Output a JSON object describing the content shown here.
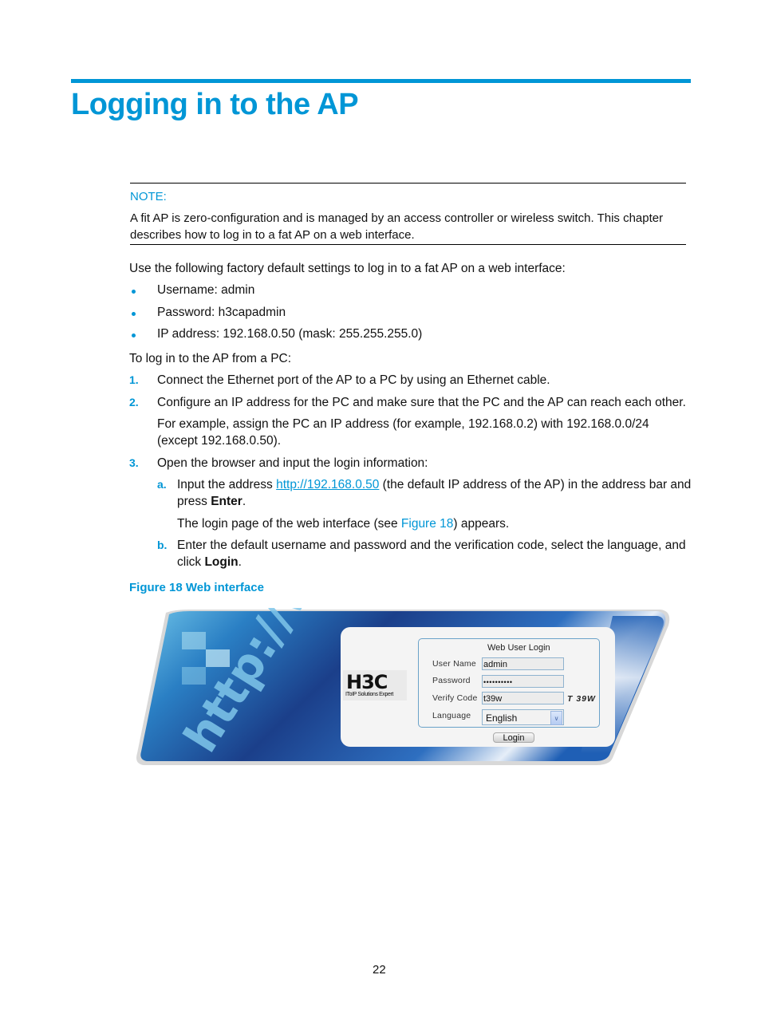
{
  "page": {
    "title": "Logging in to the AP",
    "page_number": "22"
  },
  "note": {
    "label": "NOTE:",
    "text": "A fit AP is zero-configuration and is managed by an access controller or wireless switch. This chapter describes how to log in to a fat AP on a web interface."
  },
  "intro": "Use the following factory default settings to log in to a fat AP on a web interface:",
  "defaults": [
    "Username: admin",
    "Password: h3capadmin",
    "IP address: 192.168.0.50 (mask: 255.255.255.0)"
  ],
  "steps_intro": "To log in to the AP from a PC:",
  "steps": [
    {
      "num": "1.",
      "text": "Connect the Ethernet port of the AP to a PC by using an Ethernet cable."
    },
    {
      "num": "2.",
      "text": "Configure an IP address for the PC and make sure that the PC and the AP can reach each other.",
      "sub": "For example, assign the PC an IP address (for example, 192.168.0.2) with 192.168.0.0/24 (except 192.168.0.50)."
    },
    {
      "num": "3.",
      "text": "Open the browser and input the login information:"
    }
  ],
  "substeps": {
    "a": {
      "label": "a.",
      "pre": "Input the address ",
      "link": "http://192.168.0.50",
      "post": " (the default IP address of the AP) in the address bar and press ",
      "bold": "Enter",
      "end": ".",
      "result_pre": "The login page of the web interface (see ",
      "result_link": "Figure 18",
      "result_post": ") appears."
    },
    "b": {
      "label": "b.",
      "pre": "Enter the default username and password and the verification code, select the language, and click ",
      "bold": "Login",
      "end": "."
    }
  },
  "figure": {
    "caption": "Figure 18 Web interface",
    "banner_text": "http://ww",
    "logo": "H3C",
    "logo_tagline": "IToIP Solutions Expert",
    "form_title": "Web User Login",
    "fields": {
      "username_label": "User Name",
      "username_value": "admin",
      "password_label": "Password",
      "password_value": "••••••••••",
      "verify_label": "Verify Code",
      "verify_value": "t39w",
      "captcha": "T 39W",
      "language_label": "Language",
      "language_value": "English"
    },
    "login_button": "Login",
    "colors": {
      "banner_dark": "#1b3f8a",
      "banner_light": "#e6eef8",
      "accent": "#0096d6"
    }
  }
}
